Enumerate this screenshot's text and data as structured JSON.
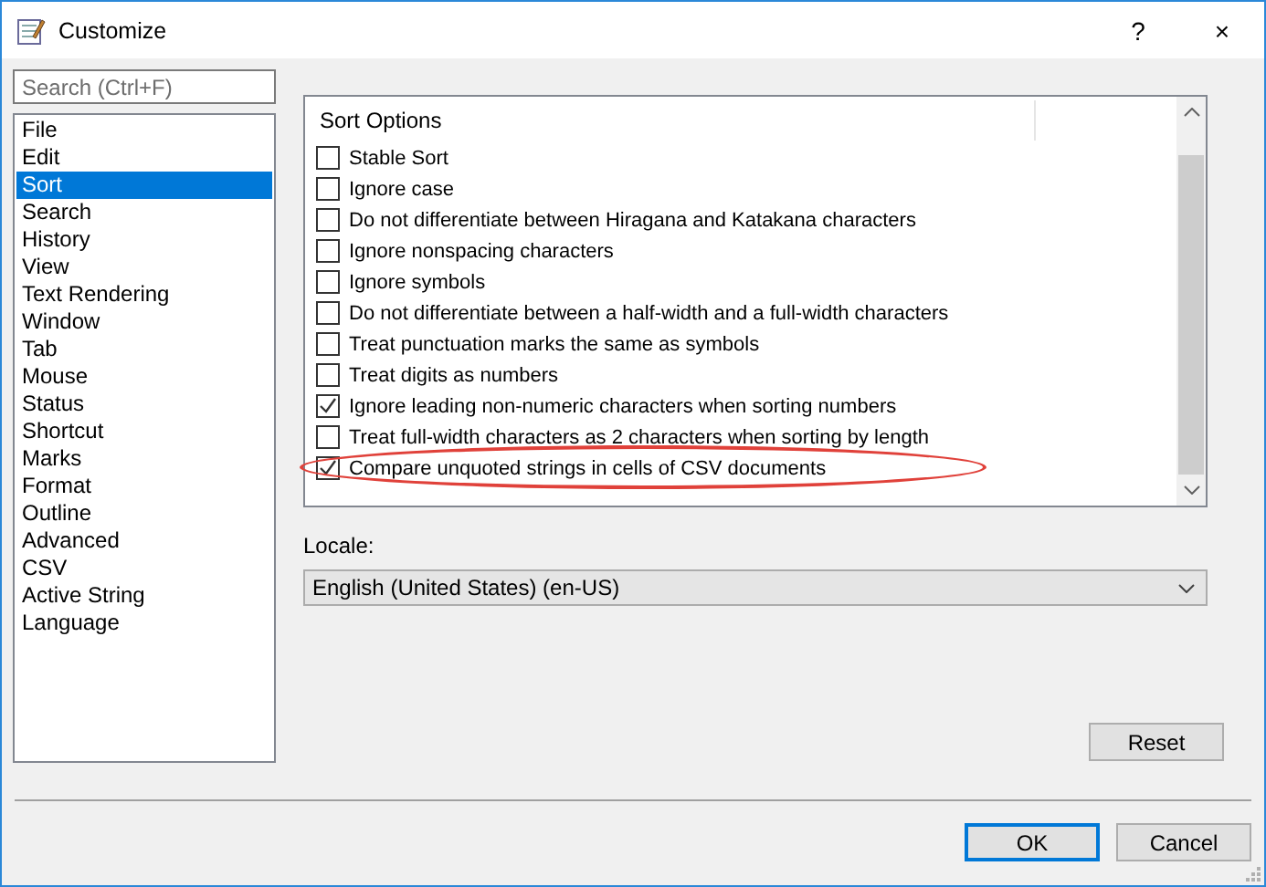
{
  "window": {
    "title": "Customize",
    "help_button": "?",
    "close_button": "×"
  },
  "search": {
    "placeholder": "Search (Ctrl+F)"
  },
  "categories": [
    {
      "label": "File",
      "selected": false
    },
    {
      "label": "Edit",
      "selected": false
    },
    {
      "label": "Sort",
      "selected": true
    },
    {
      "label": "Search",
      "selected": false
    },
    {
      "label": "History",
      "selected": false
    },
    {
      "label": "View",
      "selected": false
    },
    {
      "label": "Text Rendering",
      "selected": false
    },
    {
      "label": "Window",
      "selected": false
    },
    {
      "label": "Tab",
      "selected": false
    },
    {
      "label": "Mouse",
      "selected": false
    },
    {
      "label": "Status",
      "selected": false
    },
    {
      "label": "Shortcut",
      "selected": false
    },
    {
      "label": "Marks",
      "selected": false
    },
    {
      "label": "Format",
      "selected": false
    },
    {
      "label": "Outline",
      "selected": false
    },
    {
      "label": "Advanced",
      "selected": false
    },
    {
      "label": "CSV",
      "selected": false
    },
    {
      "label": "Active String",
      "selected": false
    },
    {
      "label": "Language",
      "selected": false
    }
  ],
  "options": {
    "header": "Sort Options",
    "items": [
      {
        "label": "Stable Sort",
        "checked": false,
        "highlighted": false
      },
      {
        "label": "Ignore case",
        "checked": false,
        "highlighted": false
      },
      {
        "label": "Do not differentiate between Hiragana and Katakana characters",
        "checked": false,
        "highlighted": false
      },
      {
        "label": "Ignore nonspacing characters",
        "checked": false,
        "highlighted": false
      },
      {
        "label": "Ignore symbols",
        "checked": false,
        "highlighted": false
      },
      {
        "label": "Do not differentiate between a half-width and a full-width characters",
        "checked": false,
        "highlighted": false
      },
      {
        "label": "Treat punctuation marks the same as symbols",
        "checked": false,
        "highlighted": false
      },
      {
        "label": "Treat digits as numbers",
        "checked": false,
        "highlighted": false
      },
      {
        "label": "Ignore leading non-numeric characters when sorting numbers",
        "checked": true,
        "highlighted": false
      },
      {
        "label": "Treat full-width characters as 2 characters when sorting by length",
        "checked": false,
        "highlighted": false
      },
      {
        "label": "Compare unquoted strings in cells of CSV documents",
        "checked": true,
        "highlighted": true
      }
    ]
  },
  "locale": {
    "label": "Locale:",
    "value": "English (United States) (en-US)"
  },
  "buttons": {
    "reset": "Reset",
    "ok": "OK",
    "cancel": "Cancel"
  }
}
